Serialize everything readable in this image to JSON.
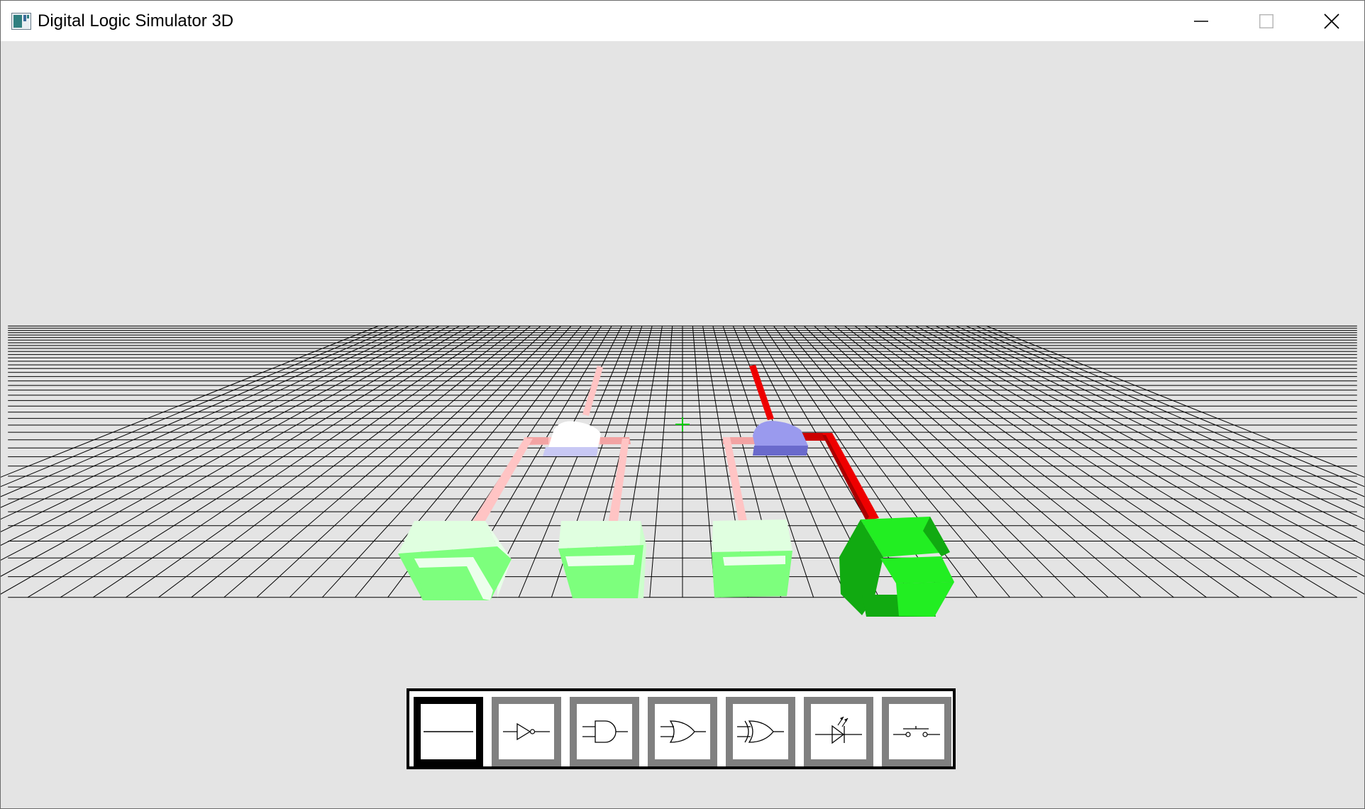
{
  "window": {
    "title": "Digital Logic Simulator 3D",
    "controls": [
      "minimize",
      "maximize",
      "close"
    ]
  },
  "viewport": {
    "background_color": "#e4e4e4",
    "grid_color": "#000000",
    "crosshair_color": "#00cc00",
    "scene": {
      "inputs": [
        {
          "id": "switch-1",
          "state": "off",
          "color": "#7dff7d"
        },
        {
          "id": "switch-2",
          "state": "off",
          "color": "#7dff7d"
        },
        {
          "id": "switch-3",
          "state": "off",
          "color": "#7dff7d"
        }
      ],
      "gates": [
        {
          "id": "gate-1",
          "type": "and",
          "output": "off",
          "color": "#ffffff"
        },
        {
          "id": "gate-2",
          "type": "and",
          "output": "on",
          "color": "#9a9aee"
        }
      ],
      "outputs": [
        {
          "id": "switch-4",
          "state": "on",
          "color": "#22ee22"
        }
      ],
      "wire_off_color": "#ffc4c4",
      "wire_on_color": "#ee0000"
    }
  },
  "toolbar": {
    "selected_index": 0,
    "tools": [
      {
        "name": "wire",
        "icon": "wire-icon",
        "selected": true
      },
      {
        "name": "not-gate",
        "icon": "not-gate-icon",
        "selected": false
      },
      {
        "name": "and-gate",
        "icon": "and-gate-icon",
        "selected": false
      },
      {
        "name": "or-gate",
        "icon": "or-gate-icon",
        "selected": false
      },
      {
        "name": "xor-gate",
        "icon": "xor-gate-icon",
        "selected": false
      },
      {
        "name": "led",
        "icon": "led-icon",
        "selected": false
      },
      {
        "name": "switch",
        "icon": "switch-icon",
        "selected": false
      }
    ]
  }
}
